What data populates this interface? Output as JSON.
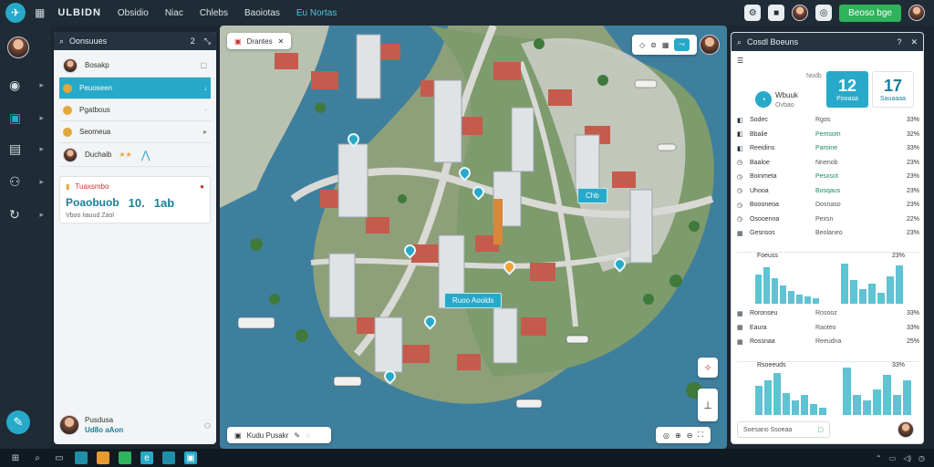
{
  "topbar": {
    "brand": "ULBIDN",
    "nav": [
      "Obsidio",
      "Niac",
      "Chlebs",
      "Baoiotas",
      "Eu Nortas"
    ],
    "active_nav": 4,
    "cta_label": "Beoso bge"
  },
  "sidebar": {
    "items": [
      "map-pin",
      "monitor",
      "document",
      "people",
      "route"
    ]
  },
  "left_panel": {
    "title": "Oonsuues",
    "count": "2",
    "contact_name": "Bosakp",
    "items": [
      {
        "label": "Peuoseen",
        "meta": "↓"
      },
      {
        "label": "Pgatbous",
        "meta": "·"
      },
      {
        "label": "Seomeua",
        "meta": "▸"
      }
    ],
    "second_contact": "Duchaib",
    "stat": {
      "header": "Tuaxsmbo",
      "values": [
        "Poaobuob",
        "10.",
        "1ab"
      ],
      "sub": "Vboo Iiauud Zaol"
    },
    "bottom_name": "Pusdusa",
    "bottom_value": "Ud8o aAon"
  },
  "map": {
    "search_chip": "Drantes",
    "label_a": "Chb",
    "label_b": "Ruoo Aoolds",
    "bottom_chip": "Kudu Pusakr"
  },
  "right_panel": {
    "title": "Cosdl Boeuns",
    "gauge_label": "Wbuuk",
    "gauge_sub": "Ovbao",
    "top_note": "Nodb",
    "kpi_a": {
      "value": "12",
      "label": "Pooasa"
    },
    "kpi_b": {
      "value": "17",
      "label": "Sauaaaa"
    },
    "rows": [
      {
        "name": "Sodec",
        "label": "Rgos",
        "value": "33%"
      },
      {
        "name": "Bbalie",
        "label": "Pemsom",
        "value": "32%"
      },
      {
        "name": "Reeidins",
        "label": "Paroine",
        "value": "33%"
      },
      {
        "name": "Baaloe",
        "label": "Nnenob",
        "value": "23%"
      },
      {
        "name": "Boinmeta",
        "label": "Pesxsot",
        "value": "23%"
      },
      {
        "name": "Uhooa",
        "label": "Bosqaus",
        "value": "23%"
      },
      {
        "name": "Boooneoa",
        "label": "Dosnaso",
        "value": "23%"
      },
      {
        "name": "Osooenna",
        "label": "Pexsn",
        "value": "22%"
      },
      {
        "name": "Gesnsos",
        "label": "Beolaneo",
        "value": "23%"
      }
    ],
    "chart1_label": "Foeuss",
    "chart1_value": "23%",
    "rows2": [
      {
        "name": "Roronseu",
        "label": "Rosooz",
        "value": "33%"
      },
      {
        "name": "Eaura",
        "label": "Raoteo",
        "value": "33%"
      },
      {
        "name": "Rossnaa",
        "label": "Reeudna",
        "value": "25%"
      }
    ],
    "chart2_label": "Rsoeeuds",
    "chart2_value": "33%",
    "search_label": "Soesano Ssoeaa"
  }
}
